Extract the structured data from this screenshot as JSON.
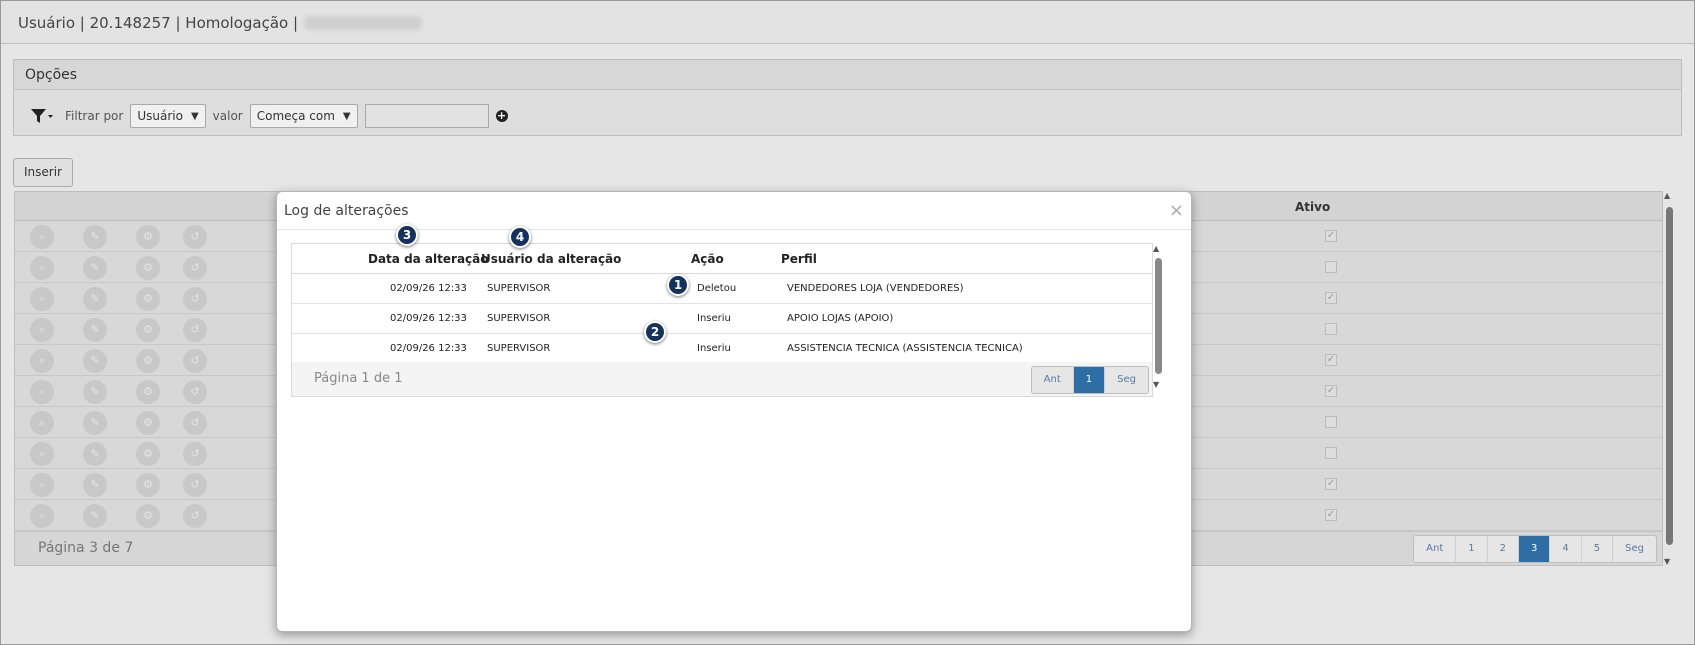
{
  "header": {
    "title": "Usuário | 20.148257 | Homologação |"
  },
  "options": {
    "title": "Opções",
    "filter_label": "Filtrar por",
    "field_select": "Usuário",
    "value_label": "valor",
    "operator_select": "Começa com",
    "value_input": ""
  },
  "toolbar": {
    "insert_label": "Inserir"
  },
  "grid": {
    "columns": [
      "Ativo"
    ],
    "rows": [
      {
        "ativo": true
      },
      {
        "ativo": false
      },
      {
        "ativo": true
      },
      {
        "ativo": false
      },
      {
        "ativo": true
      },
      {
        "ativo": true
      },
      {
        "ativo": false
      },
      {
        "ativo": false
      },
      {
        "ativo": true
      },
      {
        "ativo": true
      }
    ],
    "page_info": "Página 3 de 7",
    "pager": [
      "Ant",
      "1",
      "2",
      "3",
      "4",
      "5",
      "Seg"
    ],
    "current_page": "3"
  },
  "modal": {
    "title": "Log de alterações",
    "close": "×",
    "columns": {
      "date": "Data da alteração",
      "user": "Usuário da alteração",
      "action": "Ação",
      "profile": "Perfil"
    },
    "rows": [
      {
        "date": "02/09/26 12:33",
        "user": "SUPERVISOR",
        "action": "Deletou",
        "profile": "VENDEDORES LOJA (VENDEDORES)"
      },
      {
        "date": "02/09/26 12:33",
        "user": "SUPERVISOR",
        "action": "Inseriu",
        "profile": "APOIO LOJAS (APOIO)"
      },
      {
        "date": "02/09/26 12:33",
        "user": "SUPERVISOR",
        "action": "Inseriu",
        "profile": "ASSISTENCIA TECNICA (ASSISTENCIA TECNICA)"
      }
    ],
    "page_info": "Página 1 de 1",
    "pager": [
      "Ant",
      "1",
      "Seg"
    ],
    "current_page": "1"
  },
  "annotations": [
    "1",
    "2",
    "3",
    "4"
  ],
  "colors": {
    "accent": "#2f6ea5",
    "badge": "#15325e"
  },
  "icons": [
    "search-icon",
    "edit-icon",
    "gear-icon",
    "history-icon",
    "filter-icon",
    "plus-circle-icon",
    "close-icon",
    "scroll-up-icon",
    "scroll-down-icon"
  ]
}
